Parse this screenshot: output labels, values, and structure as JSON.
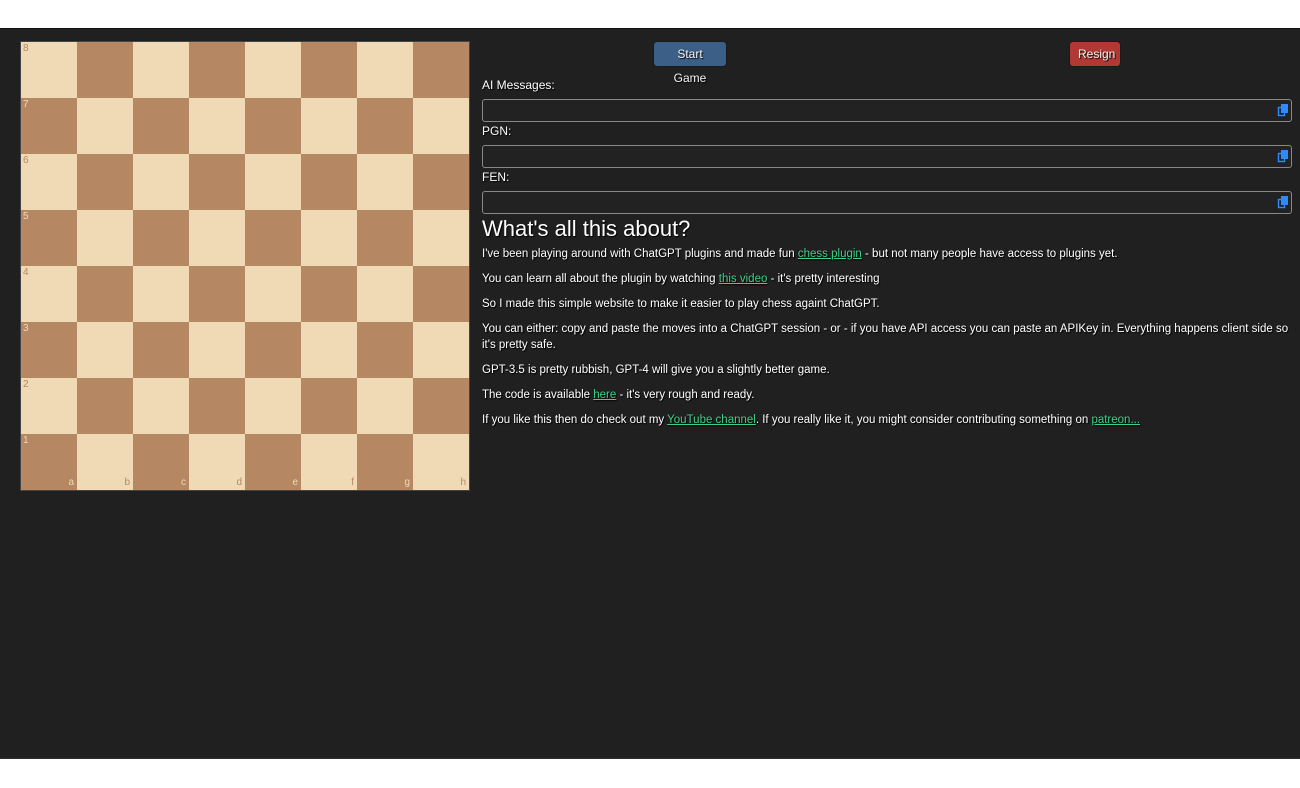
{
  "board": {
    "ranks": [
      "8",
      "7",
      "6",
      "5",
      "4",
      "3",
      "2",
      "1"
    ],
    "files": [
      "a",
      "b",
      "c",
      "d",
      "e",
      "f",
      "g",
      "h"
    ],
    "colors": {
      "light": "#f0d9b5",
      "dark": "#b58863"
    }
  },
  "controls": {
    "start_label": "Start Game",
    "resign_label": "Resign"
  },
  "fields": {
    "ai_label": "AI Messages:",
    "ai_value": "",
    "pgn_label": "PGN:",
    "pgn_value": "",
    "fen_label": "FEN:",
    "fen_value": ""
  },
  "about": {
    "heading": "What's all this about?",
    "p1_pre": "I've been playing around with ChatGPT plugins and made fun ",
    "p1_link": "chess plugin",
    "p1_post": " - but not many people have access to plugins yet.",
    "p2_pre": "You can learn all about the plugin by watching ",
    "p2_link": "this video",
    "p2_post": " - it's pretty interesting",
    "p3": "So I made this simple website to make it easier to play chess againt ChatGPT.",
    "p4": "You can either: copy and paste the moves into a ChatGPT session - or - if you have API access you can paste an APIKey in. Everything happens client side so it's pretty safe.",
    "p5": "GPT-3.5 is pretty rubbish, GPT-4 will give you a slightly better game.",
    "p6_pre": "The code is available ",
    "p6_link": "here",
    "p6_post": " - it's very rough and ready.",
    "p7_pre": "If you like this then do check out my ",
    "p7_link1": "YouTube channel",
    "p7_mid": ". If you really like it, you might consider contributing something on ",
    "p7_link2": "patreon..."
  },
  "colors": {
    "background": "#202020",
    "link": "#3fd08a",
    "start_button": "#3b5f86",
    "resign_button": "#b03a33",
    "copy_icon": "#2e8bff"
  }
}
